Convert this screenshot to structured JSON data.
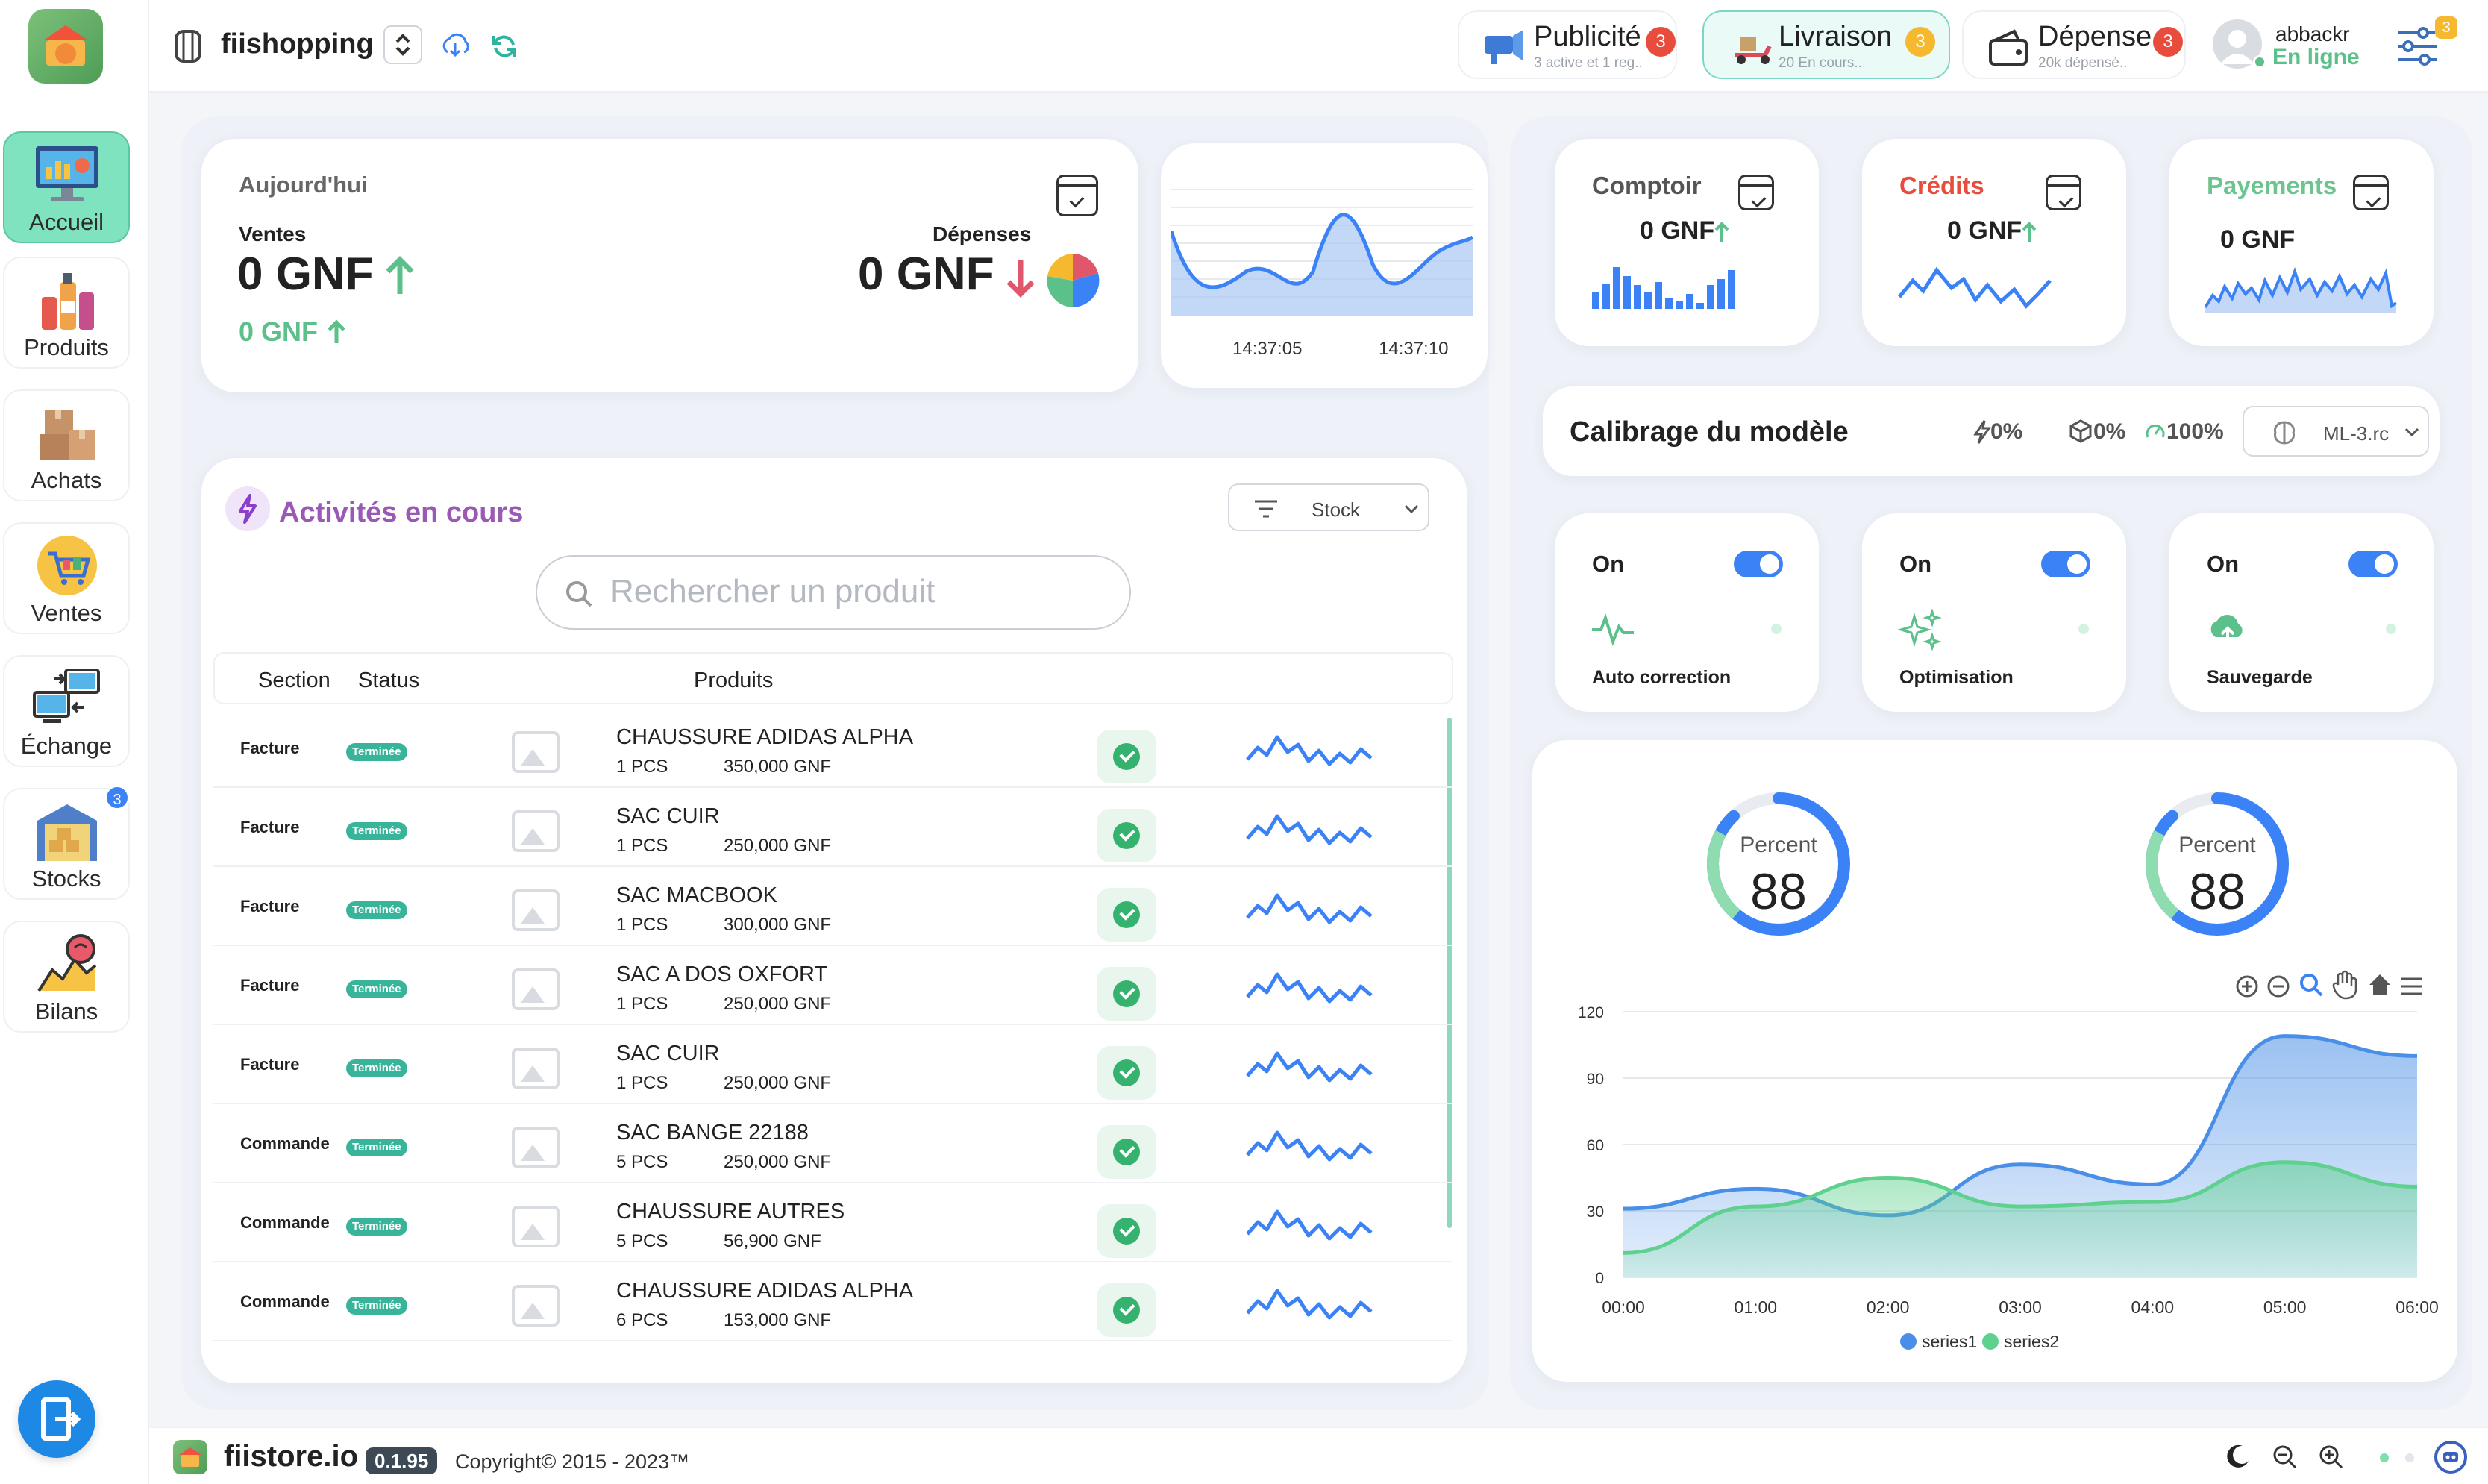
{
  "app": {
    "name": "fiishopping",
    "brand": "fiistore.io",
    "version": "0.1.95",
    "copyright": "Copyright© 2015 - 2023™"
  },
  "sidebar": {
    "items": [
      {
        "label": "Accueil",
        "icon": "dashboard-monitor-icon",
        "active": true
      },
      {
        "label": "Produits",
        "icon": "products-bottles-icon"
      },
      {
        "label": "Achats",
        "icon": "boxes-icon"
      },
      {
        "label": "Ventes",
        "icon": "shopping-cart-icon"
      },
      {
        "label": "Échange",
        "icon": "exchange-computers-icon"
      },
      {
        "label": "Stocks",
        "icon": "warehouse-icon",
        "badge": "3"
      },
      {
        "label": "Bilans",
        "icon": "chart-brain-icon"
      }
    ]
  },
  "header": {
    "pills": [
      {
        "title": "Publicité",
        "sub": "3 active et 1 reg..",
        "badge": "3",
        "badge_color": "#e74c3c"
      },
      {
        "title": "Livraison",
        "sub": "20 En cours..",
        "badge": "3",
        "badge_color": "#f5b82e"
      },
      {
        "title": "Dépense",
        "sub": "20k dépensé..",
        "badge": "3",
        "badge_color": "#e74c3c"
      }
    ],
    "user": {
      "name": "abbackr",
      "status": "En ligne"
    },
    "settings_badge": "3"
  },
  "today": {
    "title": "Aujourd'hui",
    "sales_label": "Ventes",
    "sales_value": "0 GNF",
    "sales_sub": "0 GNF",
    "expenses_label": "Dépenses",
    "expenses_value": "0 GNF"
  },
  "realtime": {
    "times": [
      "14:37:05",
      "14:37:10"
    ]
  },
  "stats": [
    {
      "label": "Comptoir",
      "value": "0 GNF",
      "color": "#555"
    },
    {
      "label": "Crédits",
      "value": "0 GNF",
      "color": "#e74c3c"
    },
    {
      "label": "Payements",
      "value": "0 GNF",
      "color": "#6cc58f"
    }
  ],
  "calibration": {
    "title": "Calibrage du modèle",
    "m1": "0%",
    "m2": "0%",
    "m3": "100%",
    "model": "ML-3.rc"
  },
  "toggles": [
    {
      "state": "On",
      "label": "Auto correction",
      "icon": "pulse-icon"
    },
    {
      "state": "On",
      "label": "Optimisation",
      "icon": "sparkles-icon"
    },
    {
      "state": "On",
      "label": "Sauvegarde",
      "icon": "cloud-upload-icon"
    }
  ],
  "activities": {
    "title": "Activités en cours",
    "filter": "Stock",
    "search_placeholder": "Rechercher un produit",
    "columns": [
      "Section",
      "Status",
      "Produits"
    ],
    "rows": [
      {
        "section": "Facture",
        "status": "Terminée",
        "name": "CHAUSSURE ADIDAS ALPHA",
        "qty": "1 PCS",
        "price": "350,000 GNF"
      },
      {
        "section": "Facture",
        "status": "Terminée",
        "name": "SAC CUIR",
        "qty": "1 PCS",
        "price": "250,000 GNF"
      },
      {
        "section": "Facture",
        "status": "Terminée",
        "name": "SAC MACBOOK",
        "qty": "1 PCS",
        "price": "300,000 GNF"
      },
      {
        "section": "Facture",
        "status": "Terminée",
        "name": "SAC A DOS OXFORT",
        "qty": "1 PCS",
        "price": "250,000 GNF"
      },
      {
        "section": "Facture",
        "status": "Terminée",
        "name": "SAC CUIR",
        "qty": "1 PCS",
        "price": "250,000 GNF"
      },
      {
        "section": "Commande",
        "status": "Terminée",
        "name": "SAC BANGE 22188",
        "qty": "5 PCS",
        "price": "250,000 GNF"
      },
      {
        "section": "Commande",
        "status": "Terminée",
        "name": "CHAUSSURE AUTRES",
        "qty": "5 PCS",
        "price": "56,900 GNF"
      },
      {
        "section": "Commande",
        "status": "Terminée",
        "name": "CHAUSSURE ADIDAS ALPHA",
        "qty": "6 PCS",
        "price": "153,000 GNF"
      }
    ]
  },
  "gauges": [
    {
      "label": "Percent",
      "value": "88"
    },
    {
      "label": "Percent",
      "value": "88"
    }
  ],
  "chart_data": {
    "type": "area",
    "x": [
      "00:00",
      "01:00",
      "02:00",
      "03:00",
      "04:00",
      "05:00",
      "06:00"
    ],
    "ylim": [
      0,
      120
    ],
    "yticks": [
      0,
      30,
      60,
      90,
      120
    ],
    "series": [
      {
        "name": "series1",
        "color": "#4a8fe7",
        "values": [
          31,
          40,
          28,
          51,
          42,
          109,
          100
        ]
      },
      {
        "name": "series2",
        "color": "#5ed18e",
        "values": [
          11,
          32,
          45,
          32,
          34,
          52,
          41
        ]
      }
    ]
  }
}
